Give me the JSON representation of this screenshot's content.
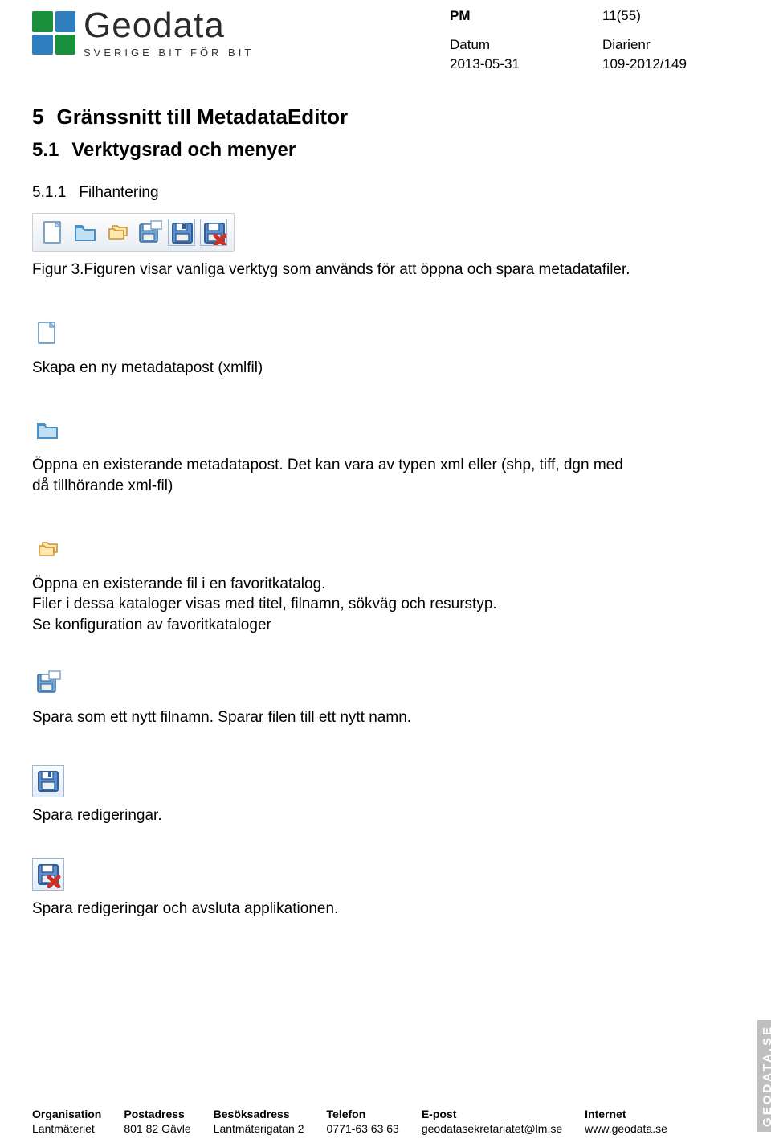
{
  "header": {
    "logo_text": "Geodata",
    "logo_sub": "SVERIGE BIT FÖR BIT",
    "pm_label": "PM",
    "page_numbers": "11(55)",
    "date_label": "Datum",
    "date_value": "2013-05-31",
    "diary_label": "Diarienr",
    "diary_value": "109-2012/149",
    "logo_colors": {
      "tl": "#1a8f3c",
      "tr": "#2f7fbf",
      "bl": "#2f7fbf",
      "br": "#1a8f3c"
    }
  },
  "sections": {
    "h1_num": "5",
    "h1_text": "Gränssnitt till MetadataEditor",
    "h2_num": "5.1",
    "h2_text": "Verktygsrad och menyer",
    "sub_num": "5.1.1",
    "sub_text": "Filhantering",
    "fig_caption": "Figur 3.Figuren visar vanliga verktyg som används för att öppna och spara metadatafiler."
  },
  "items": {
    "new_file": "Skapa en ny metadatapost (xmlfil)",
    "open_file_1": "Öppna en existerande metadatapost. Det kan vara av typen xml eller (shp, tiff, dgn med då tillhörande xml-fil)",
    "fav_1": "Öppna en existerande fil i en favoritkatalog.",
    "fav_2": "Filer i dessa kataloger visas med titel, filnamn, sökväg och resurstyp.",
    "fav_3": "Se konfiguration av favoritkataloger",
    "save_as": "Spara som ett nytt filnamn. Sparar filen till ett nytt namn.",
    "save": "Spara redigeringar.",
    "save_exit": "Spara redigeringar och avsluta applikationen."
  },
  "icons": {
    "new": "new-file-icon",
    "folder": "folder-icon",
    "fav": "favorite-folders-icon",
    "saveas": "save-as-icon",
    "save": "save-icon",
    "save_exit": "save-exit-icon"
  },
  "footer": {
    "org_h": "Organisation",
    "org_v": "Lantmäteriet",
    "post_h": "Postadress",
    "post_v": "801 82 Gävle",
    "visit_h": "Besöksadress",
    "visit_v": "Lantmäterigatan 2",
    "tel_h": "Telefon",
    "tel_v": "0771-63 63 63",
    "email_h": "E-post",
    "email_v": "geodatasekretariatet@lm.se",
    "web_h": "Internet",
    "web_v": "www.geodata.se",
    "side": "GEODATA.SE"
  }
}
